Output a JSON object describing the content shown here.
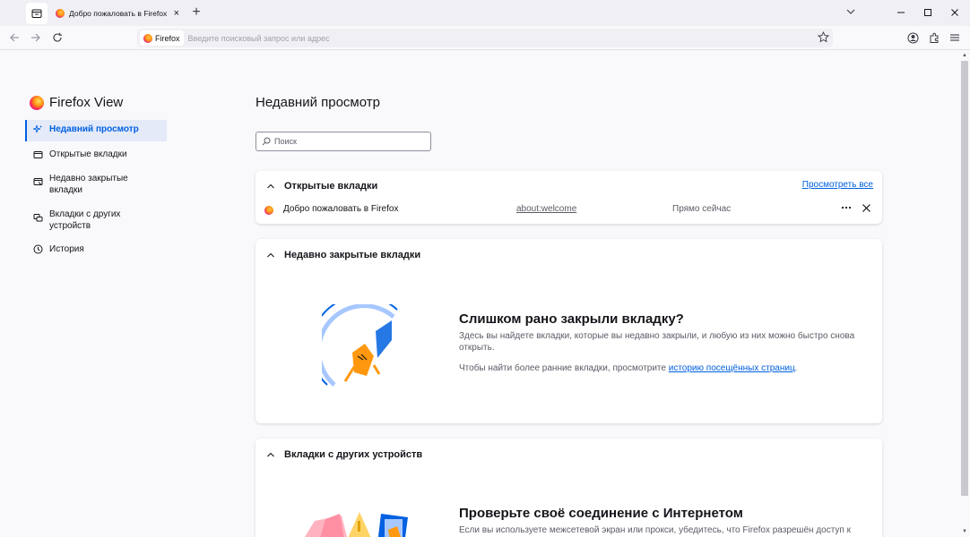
{
  "browser": {
    "tab": {
      "title": "Добро пожаловать в Firefox",
      "close": "×"
    },
    "new_tab": "+",
    "urlbar": {
      "identity_label": "Firefox",
      "placeholder": "Введите поисковый запрос или адрес"
    }
  },
  "sidebar": {
    "title": "Firefox View",
    "items": [
      {
        "label": "Недавний просмотр",
        "icon": "sparkle-icon",
        "selected": true
      },
      {
        "label": "Открытые вкладки",
        "icon": "window-icon"
      },
      {
        "label": "Недавно закрытые вкладки",
        "icon": "closed-tabs-icon"
      },
      {
        "label": "Вкладки с других устройств",
        "icon": "synced-tabs-icon"
      },
      {
        "label": "История",
        "icon": "history-icon"
      }
    ]
  },
  "main": {
    "title": "Недавний просмотр",
    "search_placeholder": "Поиск",
    "open_tabs": {
      "heading": "Открытые вкладки",
      "view_all": "Просмотреть все",
      "rows": [
        {
          "title": "Добро пожаловать в Firefox",
          "url": "about:welcome",
          "time": "Прямо сейчас"
        }
      ]
    },
    "recently_closed": {
      "heading": "Недавно закрытые вкладки",
      "empty_title": "Слишком рано закрыли вкладку?",
      "empty_text": "Здесь вы найдете вкладки, которые вы недавно закрыли, и любую из них можно быстро снова открыть.",
      "empty_hint_prefix": "Чтобы найти более ранние вкладки, просмотрите ",
      "empty_hint_link": "историю посещённых страниц",
      "empty_hint_suffix": "."
    },
    "other_devices": {
      "heading": "Вкладки с других устройств",
      "empty_title": "Проверьте своё соединение с Интернетом",
      "empty_text": "Если вы используете межсетевой экран или прокси, убедитесь, что Firefox разрешён доступ к"
    }
  },
  "colors": {
    "accent": "#0061e0",
    "selected_bg": "#e4eaf8"
  }
}
